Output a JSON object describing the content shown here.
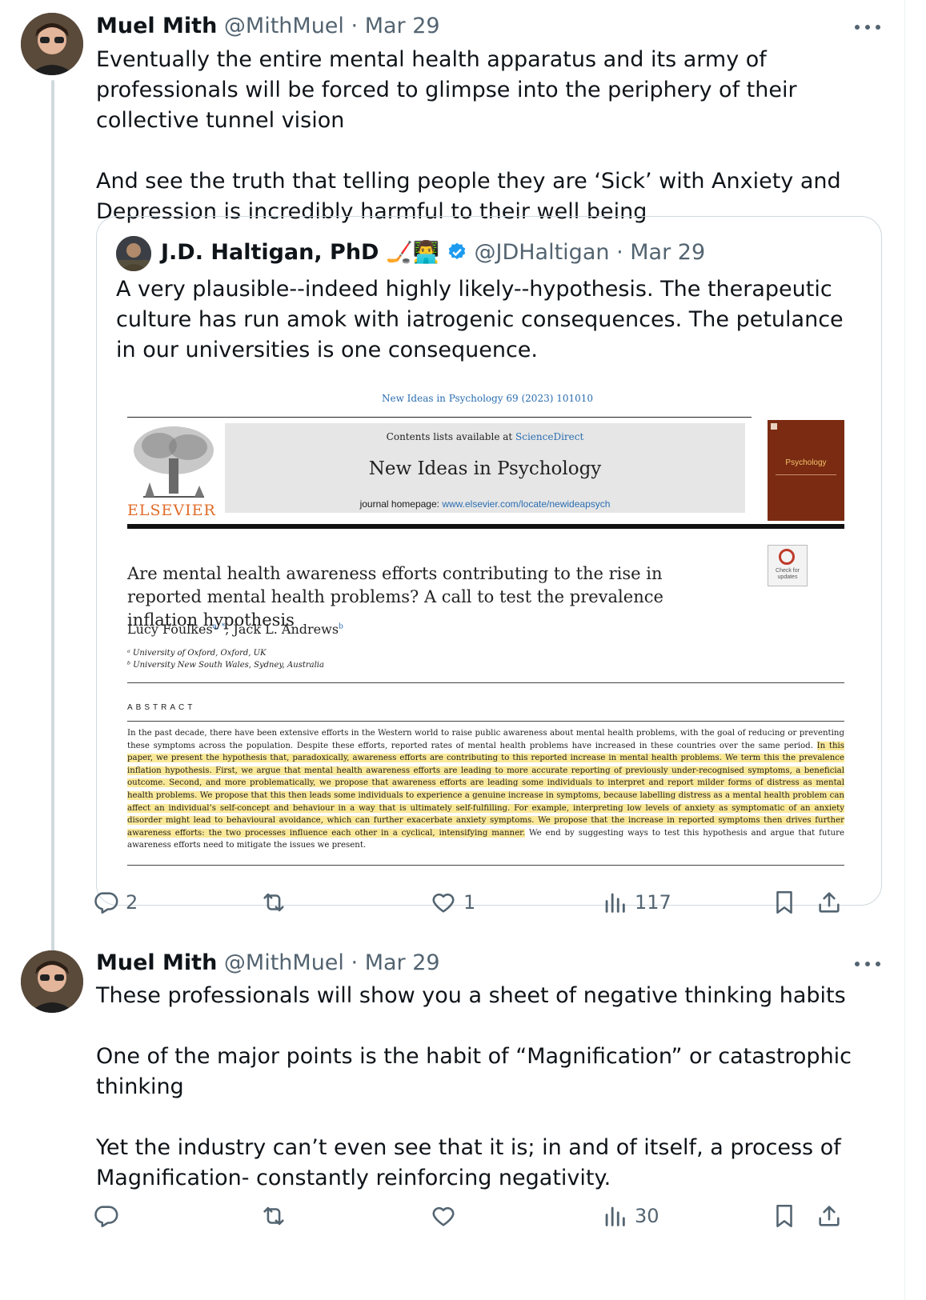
{
  "tweets": [
    {
      "name": "Muel Mith",
      "handle": "@MithMuel",
      "separator": "·",
      "date": "Mar 29",
      "paragraphs": [
        "Eventually the entire mental health apparatus and its army of professionals will be forced to glimpse into the periphery of their collective tunnel vision",
        "And see the truth that telling people they are ‘Sick’ with Anxiety and Depression is incredibly harmful to their well being"
      ],
      "actions": {
        "replies": "2",
        "retweets": "",
        "likes": "1",
        "views": "117"
      }
    },
    {
      "name": "Muel Mith",
      "handle": "@MithMuel",
      "separator": "·",
      "date": "Mar 29",
      "paragraphs": [
        "These professionals will show you a sheet of negative thinking habits",
        "One of the major points is the habit of “Magnification” or catastrophic thinking",
        "Yet the industry can’t even see that it is; in and of itself, a process of Magnification- constantly reinforcing negativity."
      ],
      "actions": {
        "replies": "",
        "retweets": "",
        "likes": "",
        "views": "30"
      }
    }
  ],
  "quoted": {
    "name": "J.D. Haltigan, PhD",
    "emoji": "🏒👨‍💻",
    "verified_icon": "verified-badge-icon",
    "handle": "@JDHaltigan",
    "separator": "·",
    "date": "Mar 29",
    "text": "A very plausible--indeed highly likely--hypothesis. The therapeutic culture has run amok with iatrogenic consequences. The petulance in our universities is one consequence.",
    "paper": {
      "journal_ref": "New Ideas in Psychology 69 (2023) 101010",
      "contents_prefix": "Contents lists available at ",
      "contents_link": "ScienceDirect",
      "journal_title": "New Ideas in Psychology",
      "homepage_prefix": "journal homepage: ",
      "homepage_link": "www.elsevier.com/locate/newideapsych",
      "publisher": "ELSEVIER",
      "cover_title": "Psychology",
      "check_label": "Check for updates",
      "title": "Are mental health awareness efforts contributing to the rise in reported mental health problems? A call to test the prevalence inflation hypothesis",
      "author1": "Lucy Foulkes",
      "author1_sup": "a, *",
      "author2": ", Jack L. Andrews",
      "author2_sup": "b",
      "affil_a": "ᵃ University of Oxford, Oxford, UK",
      "affil_b": "ᵇ University New South Wales, Sydney, Australia",
      "abstract_heading": "ABSTRACT",
      "abstract_plain": "In the past decade, there have been extensive efforts in the Western world to raise public awareness about mental health problems, with the goal of reducing or preventing these symptoms across the population. Despite these efforts, reported rates of mental health problems have increased in these countries over the same period. ",
      "abstract_highlight": "In this paper, we present the hypothesis that, paradoxically, awareness efforts are contributing to this reported increase in mental health problems. We term this the prevalence inflation hypothesis. First, we argue that mental health awareness efforts are leading to more accurate reporting of previously under-recognised symptoms, a beneficial outcome. Second, and more problematically, we propose that awareness efforts are leading some individuals to interpret and report milder forms of distress as mental health problems. We propose that this then leads some individuals to experience a genuine increase in symptoms, because labelling distress as a mental health problem can affect an individual’s self-concept and behaviour in a way that is ultimately self-fulfilling. For example, interpreting low levels of anxiety as symptomatic of an anxiety disorder might lead to behavioural avoidance, which can further exacerbate anxiety symptoms. We propose that the increase in reported symptoms then drives further awareness efforts: the two processes influence each other in a cyclical, intensifying manner.",
      "abstract_end": " We end by suggesting ways to test this hypothesis and argue that future awareness efforts need to mitigate the issues we present."
    }
  },
  "icons": {
    "reply": "reply-icon",
    "retweet": "retweet-icon",
    "like": "heart-icon",
    "views": "views-icon",
    "bookmark": "bookmark-icon",
    "share": "share-icon",
    "more": "more-icon"
  },
  "colors": {
    "text": "#0f1419",
    "secondary": "#536471",
    "verified": "#1d9bf0",
    "border": "#cfd9de",
    "highlight": "#fbe99a"
  }
}
